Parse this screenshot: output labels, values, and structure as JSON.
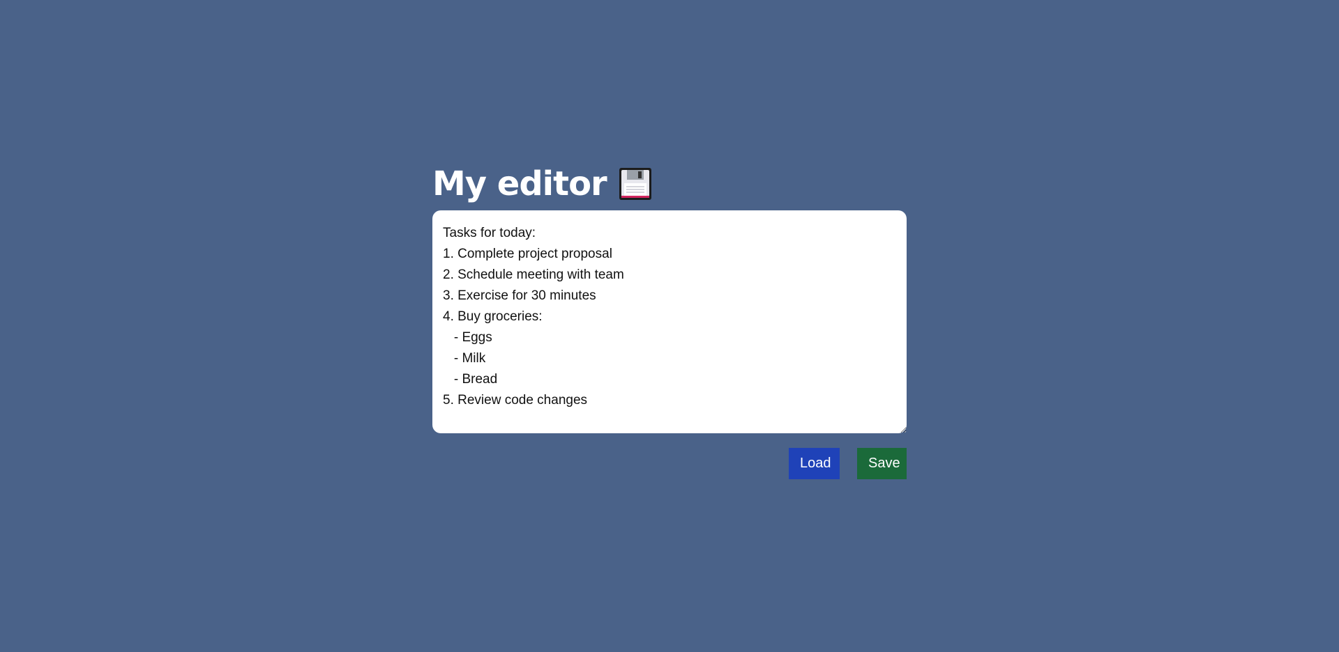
{
  "header": {
    "title": "My editor",
    "icon": "floppy-disk-icon"
  },
  "editor": {
    "value": "Tasks for today:\n1. Complete project proposal\n2. Schedule meeting with team\n3. Exercise for 30 minutes\n4. Buy groceries:\n   - Eggs\n   - Milk\n   - Bread\n5. Review code changes"
  },
  "actions": {
    "load_label": "Load",
    "save_label": "Save"
  },
  "colors": {
    "background": "#4a6289",
    "load_button": "#1f42b8",
    "save_button": "#1b6a3a",
    "editor_background": "#ffffff",
    "title_text": "#ffffff"
  }
}
